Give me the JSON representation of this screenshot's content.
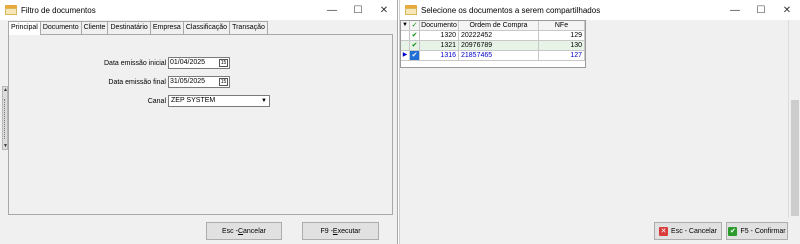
{
  "left_window": {
    "title": "Filtro de documentos",
    "tabs": [
      {
        "label": "Principal"
      },
      {
        "label": "Documento"
      },
      {
        "label": "Cliente"
      },
      {
        "label": "Destinatário"
      },
      {
        "label": "Empresa"
      },
      {
        "label": "Classificação"
      },
      {
        "label": "Transação"
      }
    ],
    "fields": {
      "data_emissao_inicial": {
        "label": "Data emissão inicial",
        "value": "01/04/2025"
      },
      "data_emissao_final": {
        "label": "Data emissão final",
        "value": "31/05/2025"
      },
      "canal": {
        "label": "Canal",
        "value": "ZEP SYSTEM"
      }
    },
    "buttons": {
      "cancelar": {
        "prefix": "Esc - ",
        "hotkey": "C",
        "rest": "ancelar"
      },
      "executar": {
        "prefix": "F9 - ",
        "hotkey": "E",
        "rest": "xecutar"
      }
    }
  },
  "right_window": {
    "title": "Selecione os documentos a serem compartilhados",
    "grid": {
      "columns": [
        "Documento",
        "Ordem de Compra",
        "NFe"
      ],
      "rows": [
        {
          "documento": "1320",
          "ordem": "20222452",
          "nfe": "129",
          "checked": true,
          "selected": false
        },
        {
          "documento": "1321",
          "ordem": "20976789",
          "nfe": "130",
          "checked": true,
          "selected": false
        },
        {
          "documento": "1316",
          "ordem": "21857465",
          "nfe": "127",
          "checked": true,
          "selected": true
        }
      ]
    },
    "buttons": {
      "cancelar": "Esc - Cancelar",
      "confirmar": "F5 - Confirmar"
    }
  },
  "icons": {
    "minimize": "minimize-icon",
    "maximize": "maximize-icon",
    "close": "close-icon",
    "calendar": "calendar-icon",
    "dropdown": "chevron-down-icon",
    "check": "check-icon",
    "cancel": "cancel-icon",
    "confirm": "confirm-icon"
  },
  "colors": {
    "checked_green": "#0a8a0a",
    "selected_text": "#0000cc",
    "selected_check_bg": "#1f6fd6",
    "row_green": "#e6f3e6",
    "cancel_red": "#d93a3a",
    "confirm_green": "#2e9b2e"
  }
}
